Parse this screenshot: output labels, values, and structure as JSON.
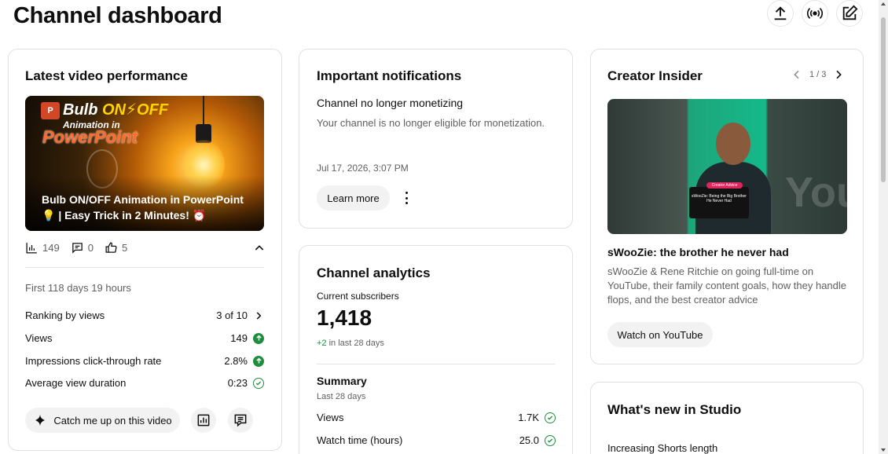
{
  "page": {
    "title": "Channel dashboard"
  },
  "top_actions": [
    {
      "icon": "upload-icon"
    },
    {
      "icon": "live-broadcast-icon"
    },
    {
      "icon": "edit-post-icon"
    }
  ],
  "latest_video": {
    "title": "Latest video performance",
    "thumbnail": {
      "brand_prefix": "Bulb ",
      "brand_on_off": "ON⚡OFF",
      "subtitle": "Animation in",
      "app": "PowerPoint",
      "logo_letter": "P"
    },
    "caption": "Bulb ON/OFF Animation in PowerPoint 💡 | Easy Trick in 2 Minutes! ⏰",
    "stats": {
      "views": "149",
      "comments": "0",
      "likes": "5"
    },
    "period": "First 118 days 19 hours",
    "metrics": [
      {
        "label": "Ranking by views",
        "value": "3 of 10",
        "indicator": "chevron"
      },
      {
        "label": "Views",
        "value": "149",
        "indicator": "up"
      },
      {
        "label": "Impressions click-through rate",
        "value": "2.8%",
        "indicator": "up"
      },
      {
        "label": "Average view duration",
        "value": "0:23",
        "indicator": "check"
      }
    ],
    "catch_up_label": "Catch me up on this video"
  },
  "notifications": {
    "title": "Important notifications",
    "heading": "Channel no longer monetizing",
    "body": "Your channel is no longer eligible for monetization.",
    "timestamp": "Jul 17, 2026, 3:07 PM",
    "learn_more_label": "Learn more"
  },
  "analytics": {
    "title": "Channel analytics",
    "subscribers_label": "Current subscribers",
    "subscribers": "1,418",
    "delta_value": "+2",
    "delta_suffix": " in last 28 days",
    "summary_title": "Summary",
    "summary_period": "Last 28 days",
    "summary_rows": [
      {
        "label": "Views",
        "value": "1.7K"
      },
      {
        "label": "Watch time (hours)",
        "value": "25.0"
      }
    ]
  },
  "creator_insider": {
    "title": "Creator Insider",
    "pager": "1 / 3",
    "image": {
      "badge": "Creator Advice",
      "card_text": "sWooZie: Being the Big Brother He Never Had",
      "bg_text": "You"
    },
    "video_title": "sWooZie: the brother he never had",
    "description": "sWooZie & Rene Ritchie on going full-time on YouTube, their family content goals, how they handle flops, and the best creator advice",
    "watch_label": "Watch on YouTube"
  },
  "whats_new": {
    "title": "What's new in Studio",
    "first_item": "Increasing Shorts length"
  },
  "colors": {
    "positive": "#1e8e3e",
    "muted_text": "#606060",
    "pill_bg": "#f2f2f2",
    "card_border": "#e0e0e0"
  }
}
